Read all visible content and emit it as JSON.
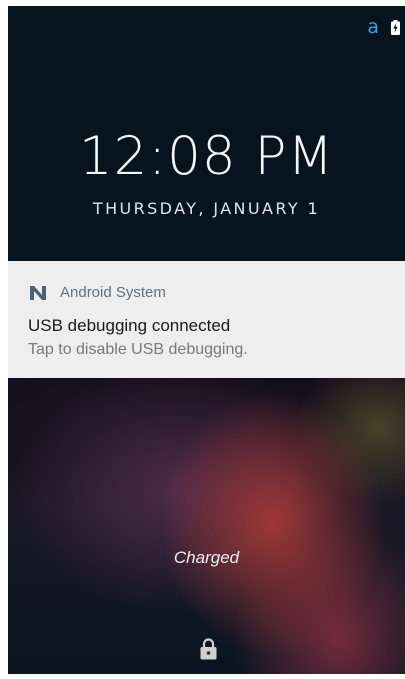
{
  "status_bar": {
    "app_letter": "a",
    "icons": [
      "app-a-icon",
      "battery-charging-icon"
    ],
    "accent_color": "#3ea0e3"
  },
  "lock_screen": {
    "time": "12:08 PM",
    "date": "THURSDAY, JANUARY 1",
    "charging_status": "Charged",
    "lock_icon": "lock-icon"
  },
  "notification": {
    "app_icon": "android-n-icon",
    "app_name": "Android System",
    "title": "USB debugging connected",
    "text": "Tap to disable USB debugging.",
    "background_color": "#eeeeee"
  }
}
